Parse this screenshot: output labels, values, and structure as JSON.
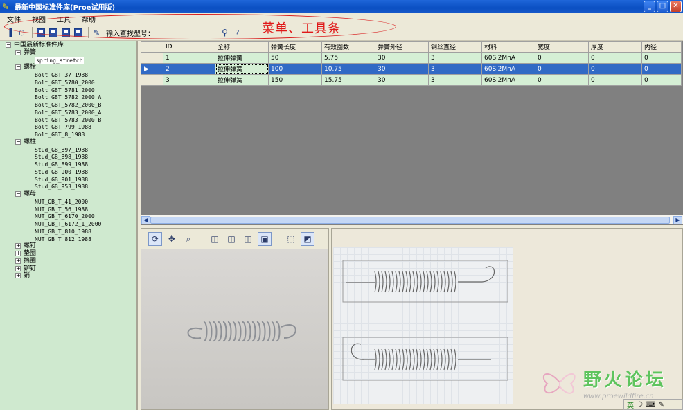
{
  "window": {
    "title": "最新中国标准件库(Proe试用版)"
  },
  "menu": [
    "文件",
    "视图",
    "工具",
    "帮助"
  ],
  "toolbar": {
    "search_label": "输入查找型号：",
    "search_value": ""
  },
  "annotation": "菜单、工具条",
  "tree": {
    "root": "中国最新标准件库",
    "groups": [
      {
        "label": "弹簧",
        "expanded": true,
        "items": [
          "spring_stretch"
        ]
      },
      {
        "label": "螺栓",
        "expanded": true,
        "items": [
          "Bolt_GBT_37_1988",
          "Bolt_GBT_5780_2000",
          "Bolt_GBT_5781_2000",
          "Bolt_GBT_5782_2000_A",
          "Bolt_GBT_5782_2000_B",
          "Bolt_GBT_5783_2000_A",
          "Bolt_GBT_5783_2000_B",
          "Bolt_GBT_799_1988",
          "Bolt_GBT_8_1988"
        ]
      },
      {
        "label": "螺柱",
        "expanded": true,
        "items": [
          "Stud_GB_897_1988",
          "Stud_GB_898_1988",
          "Stud_GB_899_1988",
          "Stud_GB_900_1988",
          "Stud_GB_901_1988",
          "Stud_GB_953_1988"
        ]
      },
      {
        "label": "螺母",
        "expanded": true,
        "items": [
          "NUT_GB_T_41_2000",
          "NUT_GB_T_56_1988",
          "NUT_GB_T_6170_2000",
          "NUT_GB_T_6172_1_2000",
          "NUT_GB_T_810_1988",
          "NUT_GB_T_812_1988"
        ]
      },
      {
        "label": "螺钉",
        "expanded": false,
        "items": []
      },
      {
        "label": "垫圈",
        "expanded": false,
        "items": []
      },
      {
        "label": "挡圈",
        "expanded": false,
        "items": []
      },
      {
        "label": "铆钉",
        "expanded": false,
        "items": []
      },
      {
        "label": "销",
        "expanded": false,
        "items": []
      }
    ]
  },
  "grid": {
    "columns": [
      "ID",
      "全称",
      "弹簧长度",
      "有效圈数",
      "弹簧外径",
      "钢丝直径",
      "材料",
      "宽度",
      "厚度",
      "内径"
    ],
    "rows": [
      [
        "1",
        "拉伸弹簧",
        "50",
        "5.75",
        "30",
        "3",
        "60Si2MnA",
        "0",
        "0",
        "0"
      ],
      [
        "2",
        "拉伸弹簧",
        "100",
        "10.75",
        "30",
        "3",
        "60Si2MnA",
        "0",
        "0",
        "0"
      ],
      [
        "3",
        "拉伸弹簧",
        "150",
        "15.75",
        "30",
        "3",
        "60Si2MnA",
        "0",
        "0",
        "0"
      ]
    ],
    "selected_row": 1
  },
  "watermark": {
    "text": "野火论坛",
    "url": "www.proewildfire.cn"
  },
  "ime": {
    "lang": "英"
  },
  "colors": {
    "titlebar": "#0a4fc2",
    "tree_bg": "#cfe9cf",
    "grid_row": "#d5efd5",
    "selection": "#316ac5",
    "annotation": "#e01818"
  }
}
